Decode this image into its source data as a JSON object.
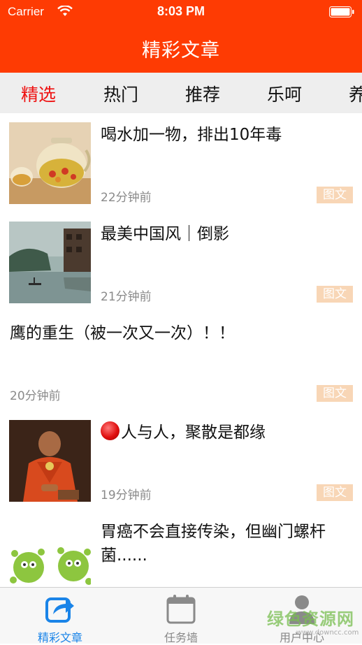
{
  "status_bar": {
    "carrier": "Carrier",
    "time": "8:03 PM"
  },
  "nav": {
    "title": "精彩文章"
  },
  "tabs": [
    {
      "label": "精选",
      "active": true
    },
    {
      "label": "热门",
      "active": false
    },
    {
      "label": "推荐",
      "active": false
    },
    {
      "label": "乐呵",
      "active": false
    },
    {
      "label": "养",
      "active": false
    }
  ],
  "articles": [
    {
      "title": "喝水加一物，排出10年毒",
      "time": "22分钟前",
      "badge": "图文",
      "thumbnail": "tea-glass-pot"
    },
    {
      "title": "最美中国风｜倒影",
      "time": "21分钟前",
      "badge": "图文",
      "thumbnail": "river-village"
    },
    {
      "title": "鹰的重生（被一次又一次）！！",
      "time": "20分钟前",
      "badge": "图文",
      "thumbnail": ""
    },
    {
      "title": "人与人，聚散是都缘",
      "time": "19分钟前",
      "badge": "图文",
      "thumbnail": "young-monk",
      "has_red_dot": true
    },
    {
      "title": "胃癌不会直接传染，但幽门螺杆菌......",
      "time": "",
      "badge": "",
      "thumbnail": "germ-cartoon"
    }
  ],
  "bottom_tabs": [
    {
      "label": "精彩文章",
      "icon": "share-icon",
      "active": true
    },
    {
      "label": "任务墙",
      "icon": "calendar-icon",
      "active": false
    },
    {
      "label": "用户中心",
      "icon": "user-icon",
      "active": false
    }
  ],
  "watermark": {
    "text": "绿色资源网",
    "url": "www.downcc.com"
  },
  "colors": {
    "brand": "#fe3b03",
    "active_tab": "#ee1111",
    "badge": "#f8d6b6",
    "tab_active": "#1a84e8"
  }
}
